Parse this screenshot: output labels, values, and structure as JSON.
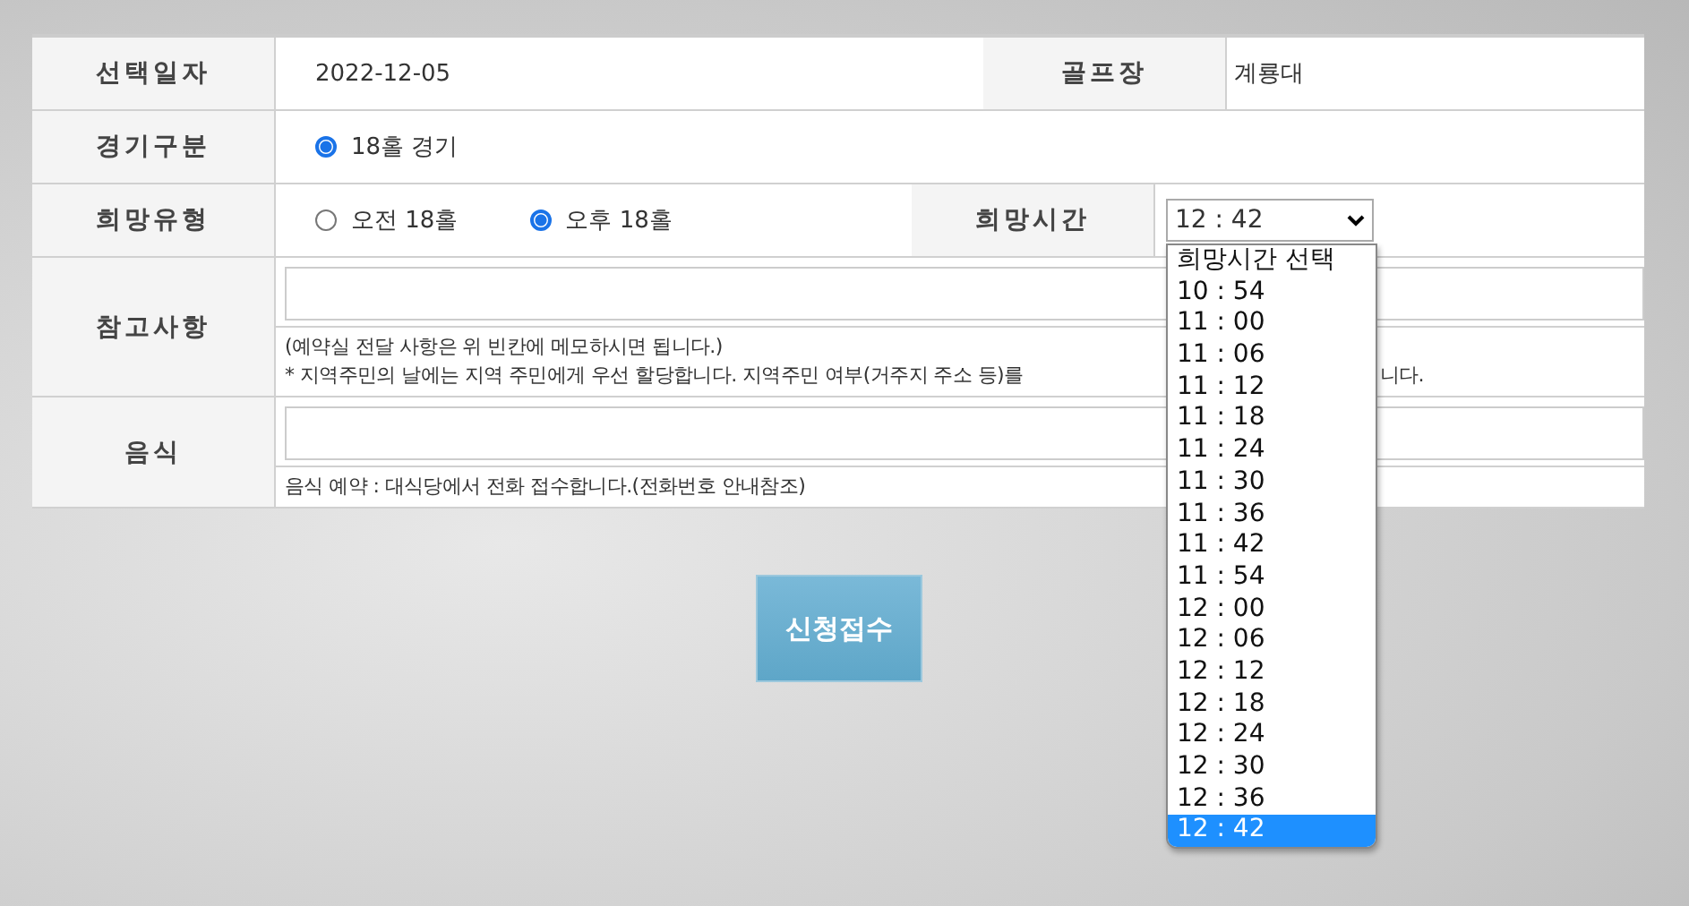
{
  "date": {
    "label": "선택일자",
    "value": "2022-12-05"
  },
  "course": {
    "label": "골프장",
    "value": "계룡대"
  },
  "game_type": {
    "label": "경기구분",
    "options": [
      {
        "label": "18홀 경기",
        "selected": true
      }
    ]
  },
  "preferred_type": {
    "label": "희망유형",
    "options": [
      {
        "label": "오전 18홀",
        "selected": false
      },
      {
        "label": "오후 18홀",
        "selected": true
      }
    ]
  },
  "preferred_time": {
    "label": "희망시간",
    "value": "12 : 42",
    "options": [
      {
        "label": "희망시간 선택",
        "selected": false
      },
      {
        "label": "10 : 54",
        "selected": false
      },
      {
        "label": "11 : 00",
        "selected": false
      },
      {
        "label": "11 : 06",
        "selected": false
      },
      {
        "label": "11 : 12",
        "selected": false
      },
      {
        "label": "11 : 18",
        "selected": false
      },
      {
        "label": "11 : 24",
        "selected": false
      },
      {
        "label": "11 : 30",
        "selected": false
      },
      {
        "label": "11 : 36",
        "selected": false
      },
      {
        "label": "11 : 42",
        "selected": false
      },
      {
        "label": "11 : 54",
        "selected": false
      },
      {
        "label": "12 : 00",
        "selected": false
      },
      {
        "label": "12 : 06",
        "selected": false
      },
      {
        "label": "12 : 12",
        "selected": false
      },
      {
        "label": "12 : 18",
        "selected": false
      },
      {
        "label": "12 : 24",
        "selected": false
      },
      {
        "label": "12 : 30",
        "selected": false
      },
      {
        "label": "12 : 36",
        "selected": false
      },
      {
        "label": "12 : 42",
        "selected": true
      }
    ]
  },
  "notes": {
    "label": "참고사항",
    "hint": "(예약실 전달 사항은 위 빈칸에 메모하시면 됩니다.)",
    "notice": "* 지역주민의 날에는 지역 주민에게 우선 할당합니다. 지역주민 여부(거주지 주소 등)를",
    "notice_tail": "니다."
  },
  "food": {
    "label": "음식",
    "hint": "음식 예약 : 대식당에서 전화 접수합니다.(전화번호 안내참조)"
  },
  "submit_button": "신청접수"
}
